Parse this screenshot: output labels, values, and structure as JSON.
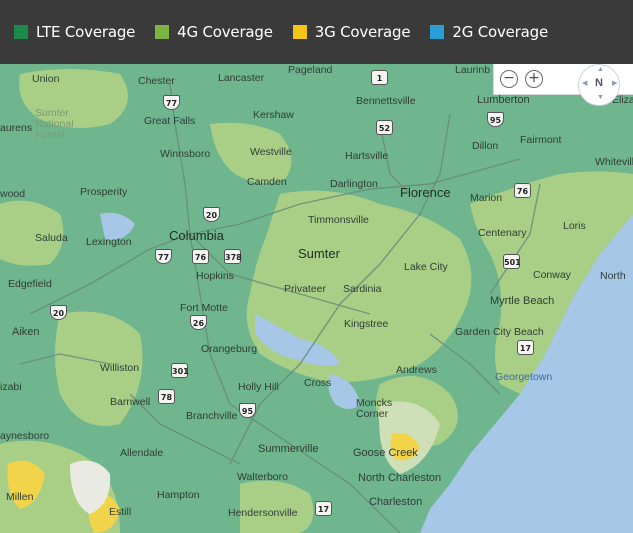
{
  "legend": {
    "items": [
      {
        "label": "LTE Coverage",
        "color": "#1e8a4a"
      },
      {
        "label": "4G Coverage",
        "color": "#7cb342"
      },
      {
        "label": "3G Coverage",
        "color": "#f5c518"
      },
      {
        "label": "2G Coverage",
        "color": "#2a9fd6"
      }
    ]
  },
  "controls": {
    "zoom_out": "−",
    "zoom_in": "+",
    "compass_label": "N"
  },
  "colors": {
    "lte": "#6fb68e",
    "g4": "#a9cf87",
    "g3": "#f2d44a",
    "water": "#a7c7e7",
    "road": "#6a8a79"
  },
  "places": {
    "union": "Union",
    "chester": "Chester",
    "lancaster": "Lancaster",
    "pageland": "Pageland",
    "laurinburg": "Laurinb",
    "lumberton": "Lumberton",
    "sumter_national_forest": "Sumter National Forest",
    "laurens": "aurens",
    "great_falls": "Great Falls",
    "kershaw": "Kershaw",
    "bennettsville": "Bennettsville",
    "elizabethtown": "Eliza",
    "fairmont": "Fairmont",
    "winnsboro": "Winnsboro",
    "westville": "Westville",
    "hartsville": "Hartsville",
    "dillon": "Dillon",
    "whiteville": "Whitevill",
    "newberry": "wood",
    "prosperity": "Prosperity",
    "camden": "Camden",
    "darlington": "Darlington",
    "florence": "Florence",
    "marion": "Marion",
    "saluda": "Saluda",
    "lexington": "Lexington",
    "columbia": "Columbia",
    "timmonsville": "Timmonsville",
    "centenary": "Centenary",
    "loris": "Loris",
    "sumter": "Sumter",
    "edgefield": "Edgefield",
    "hopkins": "Hopkins",
    "privateer": "Privateer",
    "sardinia": "Sardinia",
    "lake_city": "Lake City",
    "conway": "Conway",
    "north_myrtle": "North",
    "aiken": "Aiken",
    "fort_motte": "Fort Motte",
    "kingstree": "Kingstree",
    "myrtle_beach": "Myrtle Beach",
    "garden_city_beach": "Garden City Beach",
    "orangeburg": "Orangeburg",
    "williston": "Williston",
    "holly_hill": "Holly Hill",
    "cross": "Cross",
    "andrews": "Andrews",
    "georgetown": "Georgetown",
    "barnwell": "Barnwell",
    "branchville": "Branchville",
    "moncks_corner": "Moncks Corner",
    "waynesboro": "aynesboro",
    "allendale": "Allendale",
    "summerville": "Summerville",
    "goose_creek": "Goose Creek",
    "walterboro": "Walterboro",
    "millen": "Millen",
    "hampton": "Hampton",
    "north_charleston": "North Charleston",
    "estill": "Estill",
    "hendersonville": "Hendersonville",
    "charleston": "Charleston",
    "elizabeth_short": "izabi"
  },
  "routes": {
    "r1": "1",
    "r77n": "77",
    "r52": "52",
    "r95n": "95",
    "r76": "76",
    "r20": "20",
    "r77s": "77",
    "r76s": "76",
    "r378": "378",
    "r501": "501",
    "r20w": "20",
    "r26": "26",
    "r301": "301",
    "r17": "17",
    "r78": "78",
    "r95s": "95",
    "r17s": "17"
  }
}
